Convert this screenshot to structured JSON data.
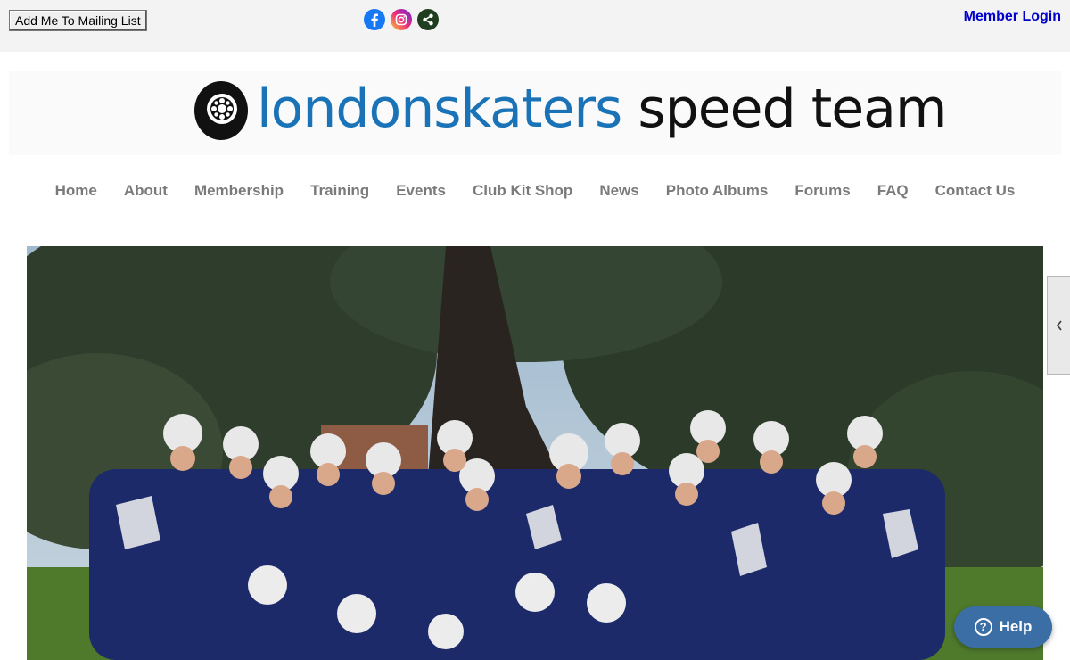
{
  "topbar": {
    "mailing_button": "Add Me To Mailing List",
    "social_icons": [
      "facebook-icon",
      "instagram-icon",
      "share-icon"
    ],
    "member_login": "Member Login"
  },
  "logo": {
    "part1": "londonskaters",
    "part2": "speed team"
  },
  "nav": {
    "items": [
      "Home",
      "About",
      "Membership",
      "Training",
      "Events",
      "Club Kit Shop",
      "News",
      "Photo Albums",
      "Forums",
      "FAQ",
      "Contact Us"
    ]
  },
  "help": {
    "label": "Help",
    "icon_glyph": "?"
  },
  "colors": {
    "topbar_bg": "#f3f3f3",
    "logo_blue": "#1a73b7",
    "nav_text": "#7a7a7a",
    "login_link": "#0000cc",
    "help_bg": "#3b6ea5"
  }
}
